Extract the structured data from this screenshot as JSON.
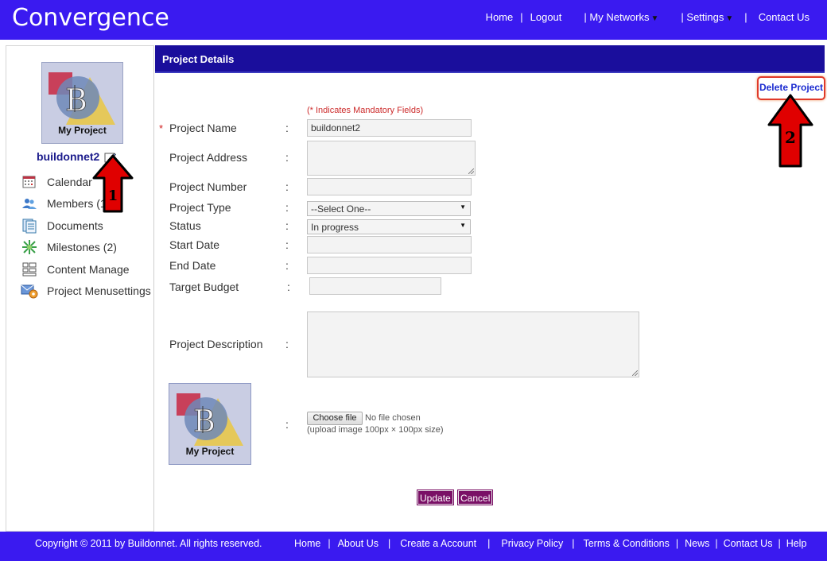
{
  "header": {
    "brand": "Convergence",
    "nav": {
      "home": "Home",
      "logout": "Logout",
      "my_networks": "| My Networks",
      "settings": "| Settings",
      "contact_us": "Contact Us"
    }
  },
  "sidebar": {
    "thumb_label": "My Project",
    "project_name": "buildonnet2",
    "items": [
      {
        "label": "Calendar",
        "icon": "calendar-icon"
      },
      {
        "label": "Members (1",
        "icon": "members-icon"
      },
      {
        "label": "Documents",
        "icon": "documents-icon"
      },
      {
        "label": "Milestones (2)",
        "icon": "milestones-icon"
      },
      {
        "label": "Content Manage",
        "icon": "content-manage-icon"
      },
      {
        "label": "Project Menusettings",
        "icon": "menu-settings-icon"
      }
    ]
  },
  "panel": {
    "title": "Project Details",
    "delete_label": "Delete Project",
    "mandatory_note": "(* Indicates Mandatory Fields)",
    "required_mark": "*",
    "colon": ":",
    "fields": {
      "project_name": {
        "label": "Project Name",
        "value": "buildonnet2"
      },
      "project_address": {
        "label": "Project Address",
        "value": ""
      },
      "project_number": {
        "label": "Project Number",
        "value": ""
      },
      "project_type": {
        "label": "Project Type",
        "value": "--Select One--"
      },
      "status": {
        "label": "Status",
        "value": "In progress"
      },
      "start_date": {
        "label": "Start Date",
        "value": ""
      },
      "end_date": {
        "label": "End Date",
        "value": ""
      },
      "target_budget": {
        "label": "Target Budget",
        "value": ""
      },
      "project_description": {
        "label": "Project Description",
        "value": ""
      }
    },
    "image_thumb_label": "My Project",
    "file_button": "Choose file",
    "file_status": "No file chosen",
    "file_hint": "(upload image 100px × 100px size)",
    "update_label": "Update",
    "cancel_label": "Cancel"
  },
  "annotations": {
    "arrow1": "1",
    "arrow2": "2"
  },
  "footer": {
    "copyright": "Copyright © 2011 by Buildonnet. All rights reserved.",
    "links": [
      "Home",
      "About Us",
      "Create a Account",
      "Privacy Policy",
      "Terms & Conditions",
      "News",
      "Contact Us",
      "Help"
    ]
  },
  "colors": {
    "header_bg": "#3a1af0",
    "panel_bar": "#1a0e9c",
    "button_bg": "#7a1066",
    "annotation_red": "#e00000"
  }
}
